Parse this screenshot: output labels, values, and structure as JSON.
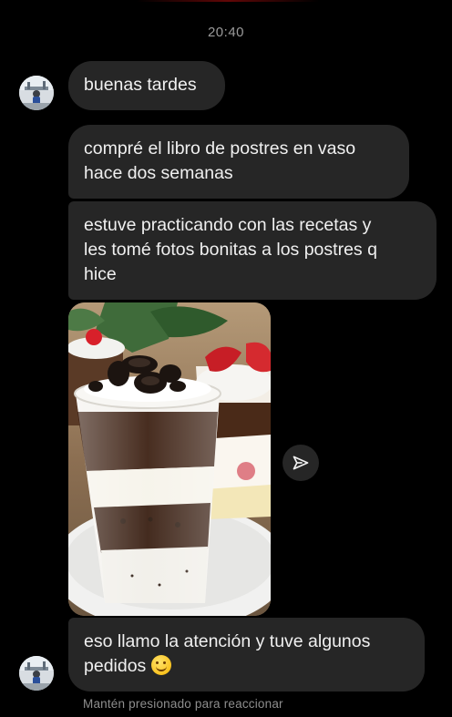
{
  "header": {
    "timestamp": "20:40"
  },
  "messages": [
    {
      "text": "buenas tardes"
    },
    {
      "text": "compré el libro de postres en vaso\nhace dos semanas"
    },
    {
      "text": "estuve practicando con las recetas y\nles tomé fotos bonitas a los postres q\nhice"
    },
    {
      "text": "eso llamo la atención y tuve algunos\npedidos"
    }
  ],
  "photo": {
    "icon": "dessert-cups-photo"
  },
  "share": {
    "icon": "send-arrow-icon"
  },
  "emoji": {
    "icon": "smiling-face-emoji"
  },
  "footer": {
    "hint": "Mantén presionado para reaccionar"
  },
  "colors": {
    "background": "#000000",
    "bubble": "#262626",
    "text": "#f0f0f0",
    "muted": "#8e8e8e"
  }
}
